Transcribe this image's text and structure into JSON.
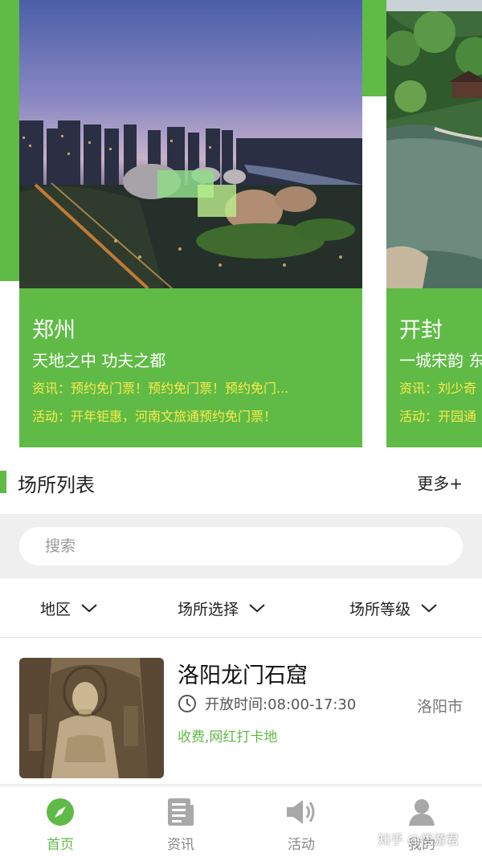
{
  "carousel": {
    "cards": [
      {
        "city": "郑州",
        "slogan": "天地之中 功夫之都",
        "news": "资讯：预约免门票！预约免门票！预约免门...",
        "activity": "活动：开年钜惠，河南文旅通预约免门票！"
      },
      {
        "city": "开封",
        "slogan": "一城宋韵 东",
        "news": "资讯：刘少奇",
        "activity": "活动：开园通"
      }
    ]
  },
  "section": {
    "title": "场所列表",
    "more": "更多+"
  },
  "search": {
    "placeholder": "搜索"
  },
  "filters": {
    "region": "地区",
    "venue": "场所选择",
    "level": "场所等级"
  },
  "venues": [
    {
      "name": "洛阳龙门石窟",
      "hours": "开放时间:08:00-17:30",
      "city": "洛阳市",
      "tags": "收费,网红打卡地"
    }
  ],
  "tabbar": {
    "items": [
      {
        "label": "首页",
        "icon": "compass-icon",
        "active": true
      },
      {
        "label": "资讯",
        "icon": "newspaper-icon",
        "active": false
      },
      {
        "label": "活动",
        "icon": "speaker-icon",
        "active": false
      },
      {
        "label": "我的",
        "icon": "user-icon",
        "active": false
      }
    ]
  },
  "watermark": "知乎 @悟游君",
  "colors": {
    "accent": "#5fbb46",
    "highlight_text": "#fde94a",
    "inactive_tab": "#888888"
  }
}
